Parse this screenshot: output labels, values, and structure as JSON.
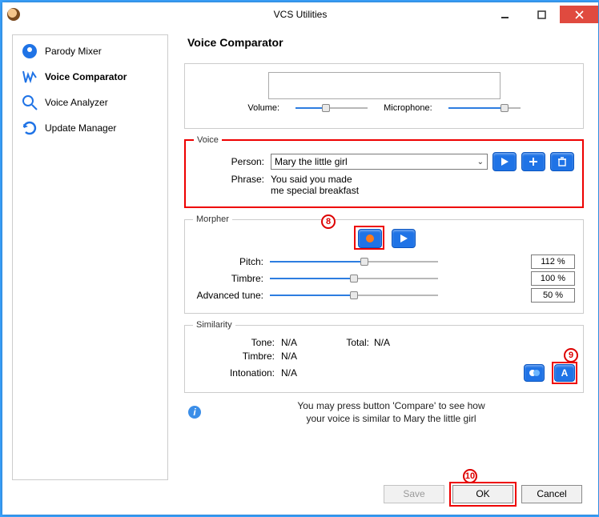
{
  "window": {
    "title": "VCS Utilities"
  },
  "sidebar": {
    "items": [
      {
        "label": "Parody Mixer"
      },
      {
        "label": "Voice Comparator"
      },
      {
        "label": "Voice Analyzer"
      },
      {
        "label": "Update Manager"
      }
    ]
  },
  "main": {
    "heading": "Voice Comparator",
    "volume_label": "Volume:",
    "microphone_label": "Microphone:",
    "volume_pct": 42,
    "microphone_pct": 78
  },
  "voice": {
    "legend": "Voice",
    "person_label": "Person:",
    "person_value": "Mary the little girl",
    "phrase_label": "Phrase:",
    "phrase_line1": "You said you made",
    "phrase_line2": "me special breakfast"
  },
  "morpher": {
    "legend": "Morpher",
    "pitch_label": "Pitch:",
    "timbre_label": "Timbre:",
    "adv_label": "Advanced tune:",
    "pitch_pct": "112 %",
    "pitch_fill": 56,
    "timbre_pct": "100 %",
    "timbre_fill": 50,
    "adv_pct": "50 %",
    "adv_fill": 50
  },
  "similarity": {
    "legend": "Similarity",
    "tone_label": "Tone:",
    "timbre_label": "Timbre:",
    "intonation_label": "Intonation:",
    "total_label": "Total:",
    "tone_value": "N/A",
    "timbre_value": "N/A",
    "intonation_value": "N/A",
    "total_value": "N/A"
  },
  "hint": {
    "line1": "You may press button 'Compare' to see how",
    "line2": "your voice is similar to Mary the little girl"
  },
  "buttons": {
    "save": "Save",
    "ok": "OK",
    "cancel": "Cancel"
  },
  "callouts": {
    "c8": "8",
    "c9": "9",
    "c10": "10"
  }
}
